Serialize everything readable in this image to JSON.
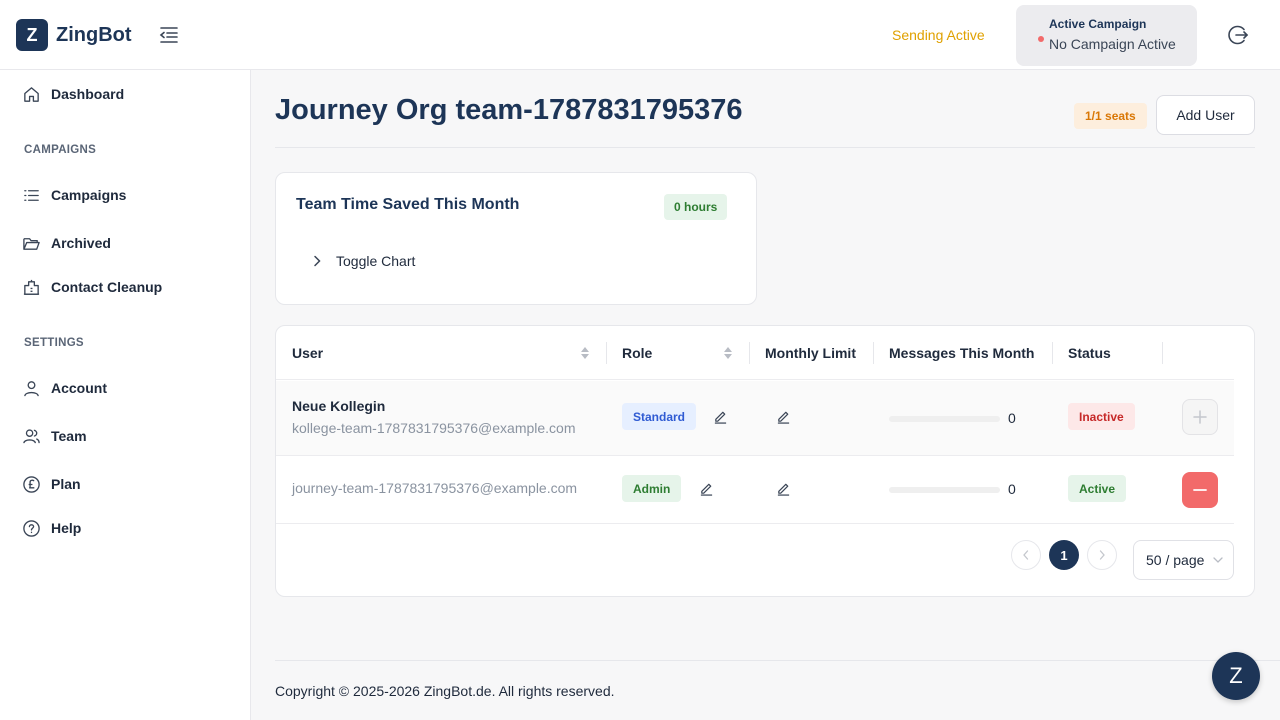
{
  "header": {
    "logo_letter": "Z",
    "brand": "ZingBot",
    "sending_status": "Sending Active",
    "campaign_label": "Active Campaign",
    "campaign_value": "No Campaign Active"
  },
  "sidebar": {
    "dashboard": "Dashboard",
    "section_campaigns": "CAMPAIGNS",
    "campaigns": "Campaigns",
    "archived": "Archived",
    "contact_cleanup": "Contact Cleanup",
    "section_settings": "SETTINGS",
    "account": "Account",
    "team": "Team",
    "plan": "Plan",
    "help": "Help"
  },
  "main": {
    "title": "Journey Org team-1787831795376",
    "seats": "1/1 seats",
    "add_user": "Add User",
    "time_card": {
      "title": "Team Time Saved This Month",
      "hours": "0 hours",
      "toggle": "Toggle Chart"
    },
    "table": {
      "columns": [
        "User",
        "Role",
        "Monthly Limit",
        "Messages This Month",
        "Status"
      ],
      "rows": [
        {
          "name": "Neue Kollegin",
          "email": "kollege-team-1787831795376@example.com",
          "role": "Standard",
          "messages": "0",
          "usage_fraction": 0,
          "status": "Inactive"
        },
        {
          "name": "",
          "email": "journey-team-1787831795376@example.com",
          "role": "Admin",
          "messages": "0",
          "usage_fraction": 0,
          "status": "Active"
        }
      ]
    },
    "pagination": {
      "current_page": "1",
      "page_size": "50 / page"
    }
  },
  "footer": {
    "copyright": "Copyright © 2025-2026 ZingBot.de. All rights reserved."
  },
  "chat": {
    "letter": "Z"
  },
  "colors": {
    "brand": "#1d3557",
    "sending": "#e0a100",
    "danger": "#f26a6a"
  }
}
